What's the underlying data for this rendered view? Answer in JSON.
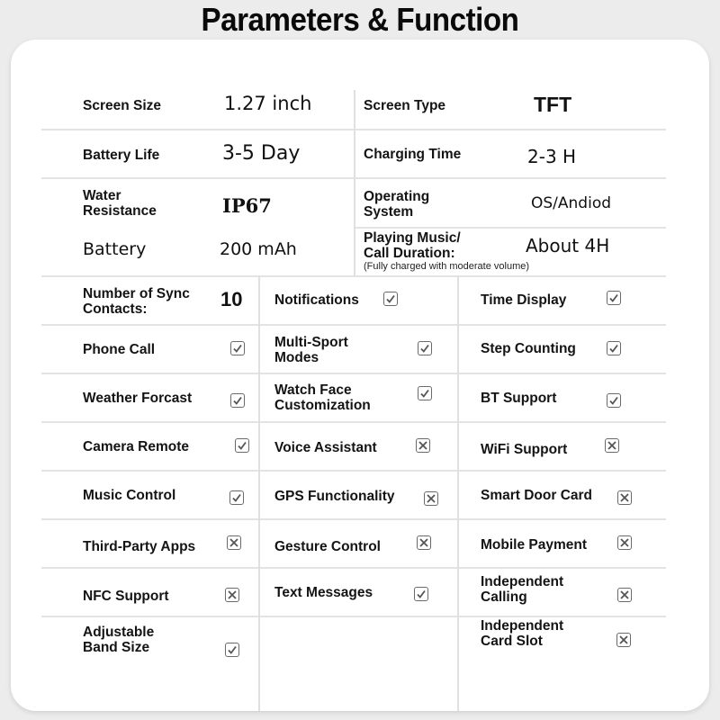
{
  "title": "Parameters & Function",
  "parameters": [
    {
      "label": "Screen Size",
      "value": "1.27 inch"
    },
    {
      "label": "Screen Type",
      "value": "TFT"
    },
    {
      "label": "Battery Life",
      "value": "3-5 Day"
    },
    {
      "label": "Charging Time",
      "value": "2-3 H"
    },
    {
      "label_line1": "Water",
      "label_line2": "Resistance",
      "value": "IP67"
    },
    {
      "label_line1": "Operating",
      "label_line2": "System",
      "value": "OS/Andiod"
    },
    {
      "label": "Battery",
      "value": "200 mAh"
    },
    {
      "label_line1": "Playing Music/",
      "label_line2": "Call Duration:",
      "note": "(Fully charged with moderate volume)",
      "value": "About 4H"
    }
  ],
  "sync_contacts": {
    "label_line1": "Number of Sync",
    "label_line2": "Contacts:",
    "value": "10"
  },
  "features": [
    {
      "label": "Notifications",
      "status": "check"
    },
    {
      "label": "Time Display",
      "status": "check"
    },
    {
      "label": "Phone Call",
      "status": "check"
    },
    {
      "label_line1": "Multi-Sport",
      "label_line2": "Modes",
      "status": "check"
    },
    {
      "label": "Step Counting",
      "status": "check"
    },
    {
      "label": "Weather Forcast",
      "status": "check"
    },
    {
      "label_line1": "Watch Face",
      "label_line2": "Customization",
      "status": "check"
    },
    {
      "label": "BT Support",
      "status": "check"
    },
    {
      "label": "Camera Remote",
      "status": "check"
    },
    {
      "label": "Voice Assistant",
      "status": "cross"
    },
    {
      "label": "WiFi Support",
      "status": "cross"
    },
    {
      "label": "Music Control",
      "status": "check"
    },
    {
      "label": "GPS Functionality",
      "status": "cross"
    },
    {
      "label": "Smart Door Card",
      "status": "cross"
    },
    {
      "label": "Third-Party Apps",
      "status": "cross"
    },
    {
      "label": "Gesture Control",
      "status": "cross"
    },
    {
      "label": "Mobile Payment",
      "status": "cross"
    },
    {
      "label": "NFC Support",
      "status": "cross"
    },
    {
      "label": "Text Messages",
      "status": "check"
    },
    {
      "label_line1": "Independent",
      "label_line2": "Calling",
      "status": "cross"
    },
    {
      "label_line1": "Adjustable",
      "label_line2": "Band Size",
      "status": "check"
    },
    {
      "label_line1": "Independent",
      "label_line2": "Card Slot",
      "status": "cross"
    }
  ],
  "icons": {
    "check": "checkbox-checked-icon",
    "cross": "checkbox-crossed-icon"
  }
}
